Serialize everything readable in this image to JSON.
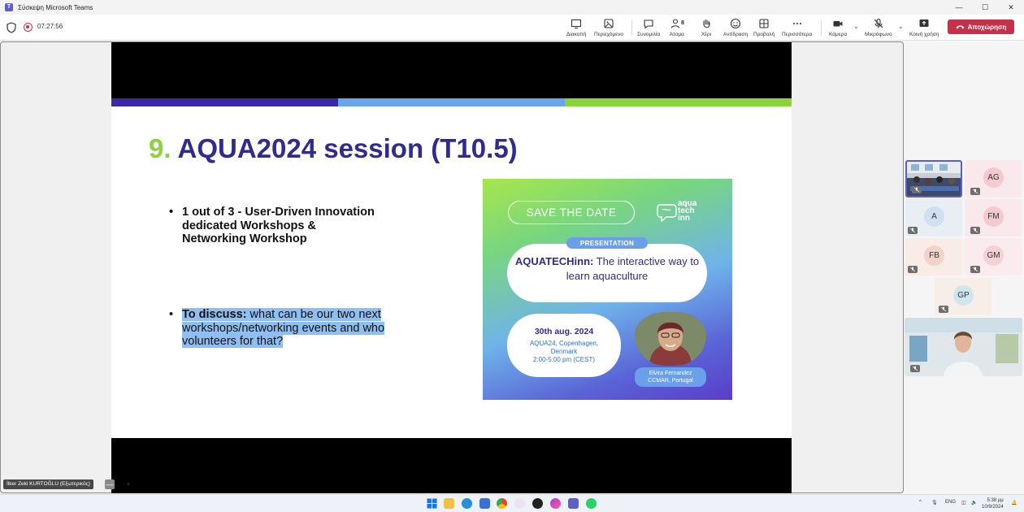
{
  "window": {
    "title": "Σύσκεψη Microsoft Teams"
  },
  "meeting": {
    "timer": "07:27:56",
    "toolbar": {
      "view": "Διακοπή",
      "content": "Περιεχόμενο",
      "chat": "Συνομιλία",
      "people": "Άτομα",
      "people_count": "8",
      "raise": "Χέρι",
      "react": "Αντίδραση",
      "layout": "Προβολή",
      "more": "Περισσότερα",
      "camera": "Κάμερα",
      "mic": "Μικρόφωνο",
      "share": "Κοινή χρήση",
      "leave": "Αποχώρηση"
    },
    "presenter_name": "İlker Zeki KURTOĞLU (Εξωτερικός)"
  },
  "slide": {
    "number": "9.",
    "title": "AQUA2024 session (T10.5)",
    "bullet1": "1 out of 3 - User-Driven Innovation dedicated Workshops & Networking Workshop",
    "bullet2_bold": "To discuss:",
    "bullet2_rest": " what can be our two next workshops/networking events and who volunteers for that?",
    "poster": {
      "save": "SAVE THE DATE",
      "logo_line1": "aqua",
      "logo_line2": "tech",
      "logo_line3": "inn",
      "pres_label": "PRESENTATION",
      "pres_title_bold": "AQUATECHinn:",
      "pres_title_rest": " The interactive way to learn aquaculture",
      "date": "30th aug. 2024",
      "place_line1": "AQUA24, Copenhagen,",
      "place_line2": "Denmark",
      "time": "2:00-5:00 pm (CEST)",
      "speaker_name": "Elvira Fernandez",
      "speaker_org": "CCMAR, Portugal"
    }
  },
  "participants": [
    {
      "initials": "",
      "video": true
    },
    {
      "initials": "AG",
      "color": "#f6c9cf"
    },
    {
      "initials": "A",
      "color": "#cfe0f3"
    },
    {
      "initials": "FM",
      "color": "#f6c9cf"
    },
    {
      "initials": "FB",
      "color": "#f3d2c8"
    },
    {
      "initials": "GM",
      "color": "#f3d2d7"
    },
    {
      "initials": "GP",
      "color": "#cfe6ee"
    }
  ],
  "taskbar": {
    "lang": "ENG",
    "time": "5:38 μμ",
    "date": "10/9/2024"
  },
  "colors": {
    "accent": "#5b5fc7",
    "leave": "#c4314b",
    "slide_title": "#2f2b8f",
    "slide_number": "#8bd33a",
    "highlight": "#8ebff0",
    "stripe1": "#3a2aa6",
    "stripe2": "#6aa4ea",
    "stripe3": "#8bd33a"
  }
}
